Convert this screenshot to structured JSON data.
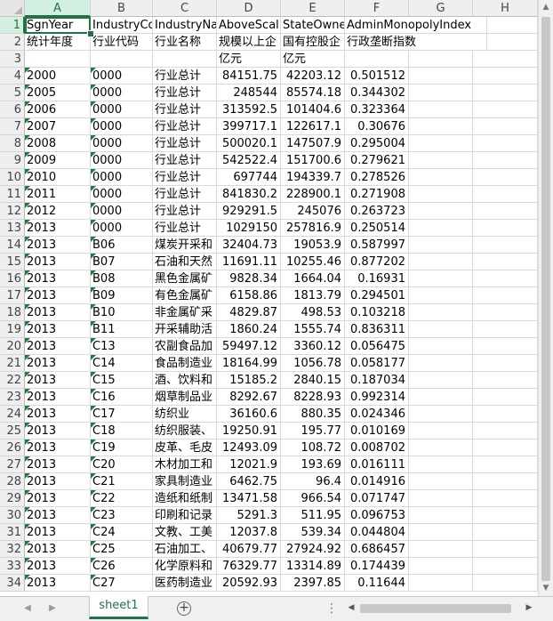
{
  "columns": [
    "A",
    "B",
    "C",
    "D",
    "E",
    "F",
    "G",
    "H"
  ],
  "selected_column": "A",
  "selected_row": "1",
  "rows": [
    {
      "num": "1",
      "cells": [
        "SgnYear",
        "IndustryCo",
        "IndustryNa",
        "AboveScal",
        "StateOwne",
        "AdminMonopolyIndex",
        "",
        ""
      ]
    },
    {
      "num": "2",
      "cells": [
        "统计年度",
        "行业代码",
        "行业名称",
        "规模以上企",
        "国有控股企",
        "行政垄断指数",
        "",
        ""
      ]
    },
    {
      "num": "3",
      "cells": [
        "",
        "",
        "",
        "亿元",
        "亿元",
        "",
        "",
        ""
      ]
    },
    {
      "num": "4",
      "cells": [
        "2000",
        "0000",
        "行业总计",
        "84151.75",
        "42203.12",
        "0.501512",
        "",
        ""
      ]
    },
    {
      "num": "5",
      "cells": [
        "2005",
        "0000",
        "行业总计",
        "248544",
        "85574.18",
        "0.344302",
        "",
        ""
      ]
    },
    {
      "num": "6",
      "cells": [
        "2006",
        "0000",
        "行业总计",
        "313592.5",
        "101404.6",
        "0.323364",
        "",
        ""
      ]
    },
    {
      "num": "7",
      "cells": [
        "2007",
        "0000",
        "行业总计",
        "399717.1",
        "122617.1",
        "0.30676",
        "",
        ""
      ]
    },
    {
      "num": "8",
      "cells": [
        "2008",
        "0000",
        "行业总计",
        "500020.1",
        "147507.9",
        "0.295004",
        "",
        ""
      ]
    },
    {
      "num": "9",
      "cells": [
        "2009",
        "0000",
        "行业总计",
        "542522.4",
        "151700.6",
        "0.279621",
        "",
        ""
      ]
    },
    {
      "num": "10",
      "cells": [
        "2010",
        "0000",
        "行业总计",
        "697744",
        "194339.7",
        "0.278526",
        "",
        ""
      ]
    },
    {
      "num": "11",
      "cells": [
        "2011",
        "0000",
        "行业总计",
        "841830.2",
        "228900.1",
        "0.271908",
        "",
        ""
      ]
    },
    {
      "num": "12",
      "cells": [
        "2012",
        "0000",
        "行业总计",
        "929291.5",
        "245076",
        "0.263723",
        "",
        ""
      ]
    },
    {
      "num": "13",
      "cells": [
        "2013",
        "0000",
        "行业总计",
        "1029150",
        "257816.9",
        "0.250514",
        "",
        ""
      ]
    },
    {
      "num": "14",
      "cells": [
        "2013",
        "B06",
        "煤炭开采和",
        "32404.73",
        "19053.9",
        "0.587997",
        "",
        ""
      ]
    },
    {
      "num": "15",
      "cells": [
        "2013",
        "B07",
        "石油和天然",
        "11691.11",
        "10255.46",
        "0.877202",
        "",
        ""
      ]
    },
    {
      "num": "16",
      "cells": [
        "2013",
        "B08",
        "黑色金属矿",
        "9828.34",
        "1664.04",
        "0.16931",
        "",
        ""
      ]
    },
    {
      "num": "17",
      "cells": [
        "2013",
        "B09",
        "有色金属矿",
        "6158.86",
        "1813.79",
        "0.294501",
        "",
        ""
      ]
    },
    {
      "num": "18",
      "cells": [
        "2013",
        "B10",
        "非金属矿采",
        "4829.87",
        "498.53",
        "0.103218",
        "",
        ""
      ]
    },
    {
      "num": "19",
      "cells": [
        "2013",
        "B11",
        "开采辅助活",
        "1860.24",
        "1555.74",
        "0.836311",
        "",
        ""
      ]
    },
    {
      "num": "20",
      "cells": [
        "2013",
        "C13",
        "农副食品加",
        "59497.12",
        "3360.12",
        "0.056475",
        "",
        ""
      ]
    },
    {
      "num": "21",
      "cells": [
        "2013",
        "C14",
        "食品制造业",
        "18164.99",
        "1056.78",
        "0.058177",
        "",
        ""
      ]
    },
    {
      "num": "22",
      "cells": [
        "2013",
        "C15",
        "酒、饮料和",
        "15185.2",
        "2840.15",
        "0.187034",
        "",
        ""
      ]
    },
    {
      "num": "23",
      "cells": [
        "2013",
        "C16",
        "烟草制品业",
        "8292.67",
        "8228.93",
        "0.992314",
        "",
        ""
      ]
    },
    {
      "num": "24",
      "cells": [
        "2013",
        "C17",
        "纺织业",
        "36160.6",
        "880.35",
        "0.024346",
        "",
        ""
      ]
    },
    {
      "num": "25",
      "cells": [
        "2013",
        "C18",
        "纺织服装、",
        "19250.91",
        "195.77",
        "0.010169",
        "",
        ""
      ]
    },
    {
      "num": "26",
      "cells": [
        "2013",
        "C19",
        "皮革、毛皮",
        "12493.09",
        "108.72",
        "0.008702",
        "",
        ""
      ]
    },
    {
      "num": "27",
      "cells": [
        "2013",
        "C20",
        "木材加工和",
        "12021.9",
        "193.69",
        "0.016111",
        "",
        ""
      ]
    },
    {
      "num": "28",
      "cells": [
        "2013",
        "C21",
        "家具制造业",
        "6462.75",
        "96.4",
        "0.014916",
        "",
        ""
      ]
    },
    {
      "num": "29",
      "cells": [
        "2013",
        "C22",
        "造纸和纸制",
        "13471.58",
        "966.54",
        "0.071747",
        "",
        ""
      ]
    },
    {
      "num": "30",
      "cells": [
        "2013",
        "C23",
        "印刷和记录",
        "5291.3",
        "511.95",
        "0.096753",
        "",
        ""
      ]
    },
    {
      "num": "31",
      "cells": [
        "2013",
        "C24",
        "文教、工美",
        "12037.8",
        "539.34",
        "0.044804",
        "",
        ""
      ]
    },
    {
      "num": "32",
      "cells": [
        "2013",
        "C25",
        "石油加工、",
        "40679.77",
        "27924.92",
        "0.686457",
        "",
        ""
      ]
    },
    {
      "num": "33",
      "cells": [
        "2013",
        "C26",
        "化学原料和",
        "76329.77",
        "13314.89",
        "0.174439",
        "",
        ""
      ]
    },
    {
      "num": "34",
      "cells": [
        "2013",
        "C27",
        "医药制造业",
        "20592.93",
        "2397.85",
        "0.11644",
        "",
        ""
      ]
    }
  ],
  "sheet_tabs": [
    {
      "label": "sheet1",
      "active": true
    }
  ],
  "icons": {
    "add_sheet": "plus-circle-icon",
    "nav_prev": "triangle-left-icon",
    "nav_next": "triangle-right-icon",
    "more": "ellipsis-icon"
  },
  "colors": {
    "accent": "#217346",
    "grid": "#dadada",
    "header_bg": "#efefef"
  }
}
